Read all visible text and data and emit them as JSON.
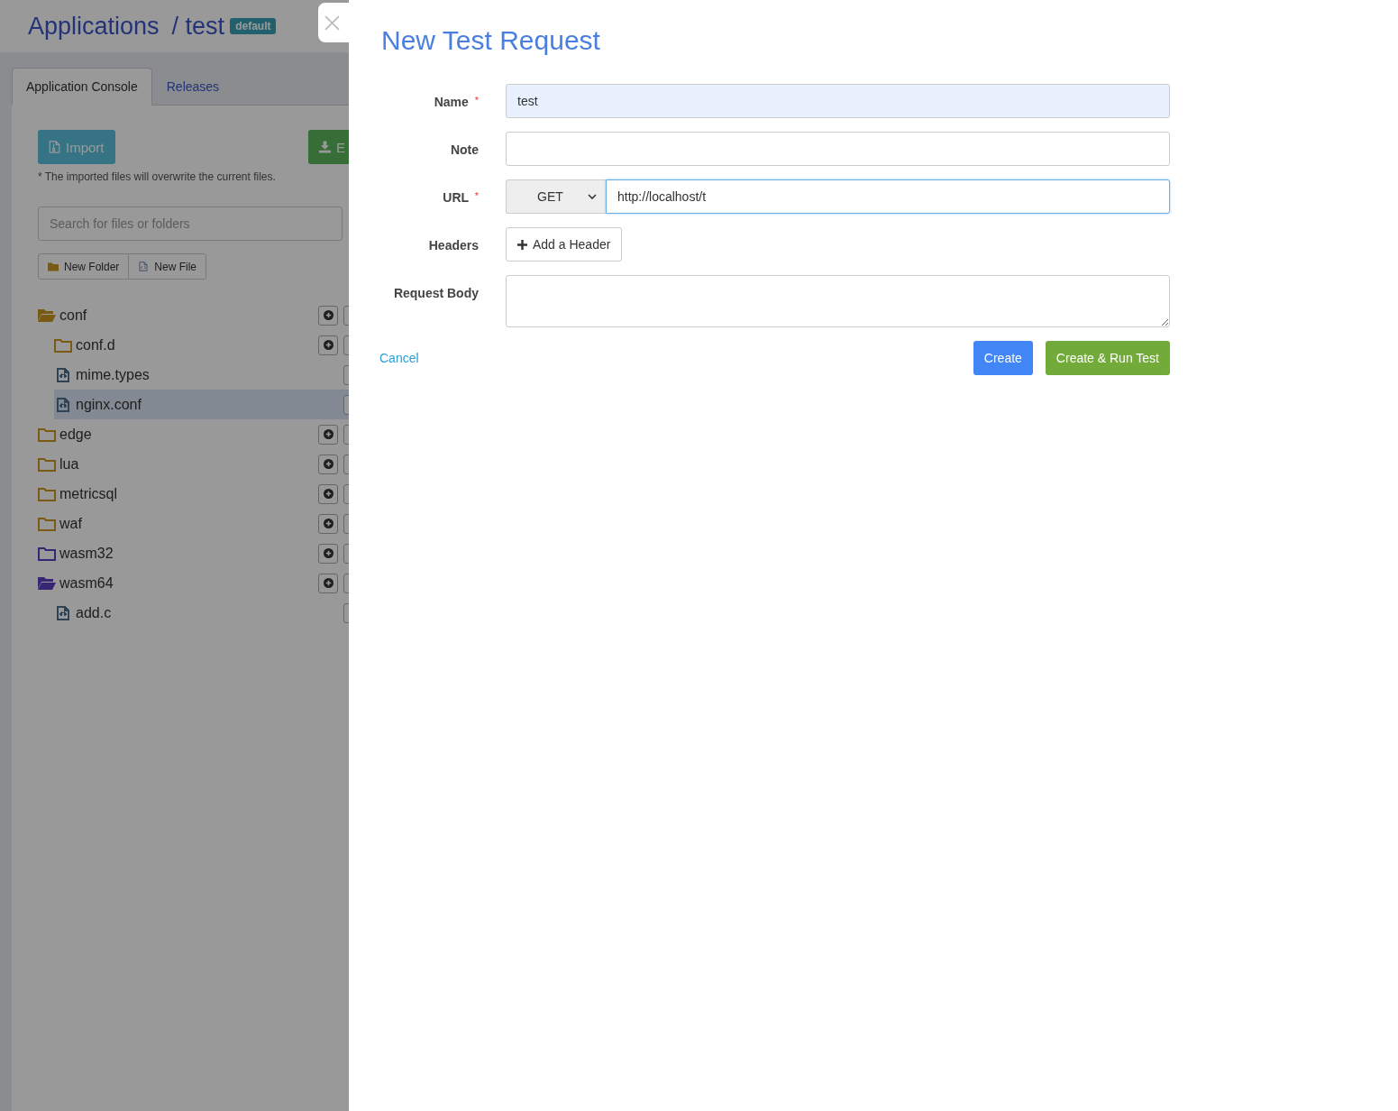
{
  "header": {
    "title": "Applications",
    "app_name": "/ test",
    "badge": "default"
  },
  "tabs": [
    {
      "label": "Application Console",
      "selected": true
    },
    {
      "label": "Releases",
      "selected": false
    }
  ],
  "import_button": "Import",
  "export_button": "E",
  "import_note": "* The imported files will overwrite the current files.",
  "search": {
    "placeholder": "Search for files or folders"
  },
  "new_folder_button": "New Folder",
  "new_file_button": "New File",
  "tree": [
    {
      "name": "conf",
      "kind": "folder",
      "expanded": true,
      "selected": false,
      "color": "#785a12",
      "children": [
        {
          "name": "conf.d",
          "kind": "folder",
          "expanded": false,
          "selected": false,
          "color": "#785a12"
        },
        {
          "name": "mime.types",
          "kind": "file",
          "selected": false,
          "color": "#2f4356"
        },
        {
          "name": "nginx.conf",
          "kind": "file",
          "selected": true,
          "color": "#2f4356"
        }
      ]
    },
    {
      "name": "edge",
      "kind": "folder",
      "expanded": false,
      "selected": false,
      "color": "#785a12"
    },
    {
      "name": "lua",
      "kind": "folder",
      "expanded": false,
      "selected": false,
      "color": "#785a12"
    },
    {
      "name": "metricsql",
      "kind": "folder",
      "expanded": false,
      "selected": false,
      "color": "#785a12"
    },
    {
      "name": "waf",
      "kind": "folder",
      "expanded": false,
      "selected": false,
      "color": "#785a12"
    },
    {
      "name": "wasm32",
      "kind": "folder",
      "expanded": false,
      "selected": false,
      "color": "#362673"
    },
    {
      "name": "wasm64",
      "kind": "folder",
      "expanded": true,
      "selected": false,
      "color": "#362673",
      "children": [
        {
          "name": "add.c",
          "kind": "file",
          "selected": false,
          "color": "#2f4356"
        }
      ]
    }
  ],
  "drawer": {
    "title": "New Test Request",
    "required_mark": "*",
    "fields": [
      {
        "kind": "text",
        "label": "Name",
        "required": true,
        "value": "test",
        "autofilled": true,
        "focused": false
      },
      {
        "kind": "text",
        "label": "Note",
        "required": false,
        "autofilled": false,
        "focused": false
      },
      {
        "kind": "url",
        "label": "URL",
        "required": true,
        "method": "GET",
        "value": "http://localhost/t",
        "autofilled": false,
        "focused": true
      },
      {
        "kind": "button",
        "label": "Headers",
        "required": false,
        "button": "Add a Header"
      },
      {
        "kind": "textarea",
        "label": "Request Body",
        "required": false,
        "autofilled": false,
        "focused": false
      }
    ],
    "cancel": "Cancel",
    "create": "Create",
    "create_run": "Create & Run Test"
  }
}
